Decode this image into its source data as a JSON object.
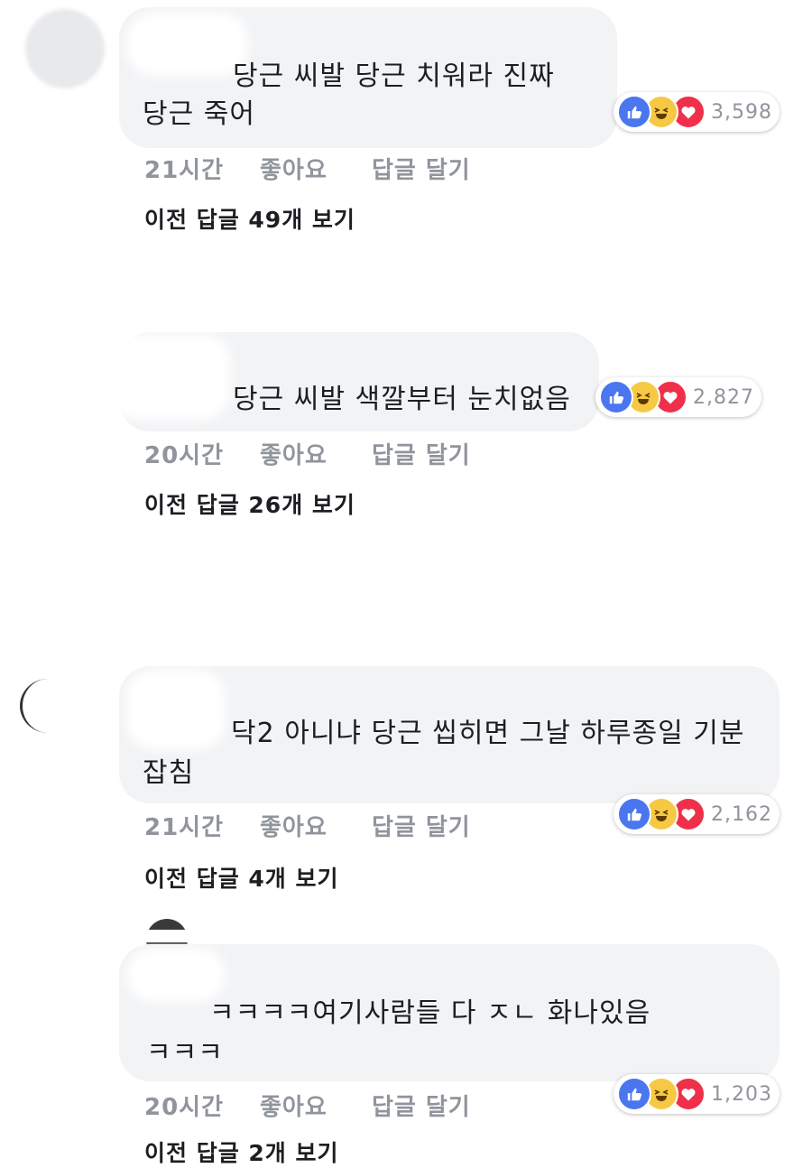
{
  "comments": [
    {
      "text_line1": "당근 씨발 당근 치워라 진짜",
      "text_line2": "당근 죽어",
      "reaction_count": "3,598",
      "time": "21시간",
      "like": "좋아요",
      "reply": "답글 달기",
      "view_replies": "이전 답글 49개 보기"
    },
    {
      "text_line1": "당근 씨발 색깔부터 눈치없음",
      "reaction_count": "2,827",
      "time": "20시간",
      "like": "좋아요",
      "reply": "답글 달기",
      "view_replies": "이전 답글 26개 보기"
    },
    {
      "text_line1": "닥2 아니냐 당근 씹히면 그날 하루종일 기분",
      "text_line2": "잡침",
      "reaction_count": "2,162",
      "time": "21시간",
      "like": "좋아요",
      "reply": "답글 달기",
      "view_replies": "이전 답글 4개 보기"
    },
    {
      "text_line1": "ㅋㅋㅋㅋ여기사람들 다 ㅈㄴ 화나있음",
      "text_line2": "ㅋㅋㅋ",
      "reaction_count": "1,203",
      "time": "20시간",
      "like": "좋아요",
      "reply": "답글 달기",
      "view_replies": "이전 답글 2개 보기"
    }
  ],
  "icons": {
    "like": "thumbs-up-icon",
    "haha": "laughing-face-icon",
    "love": "heart-icon"
  },
  "colors": {
    "like": "#4a76f0",
    "haha": "#f7c843",
    "love": "#f0304a",
    "bubble": "#f2f3f5",
    "meta": "#90949c"
  }
}
